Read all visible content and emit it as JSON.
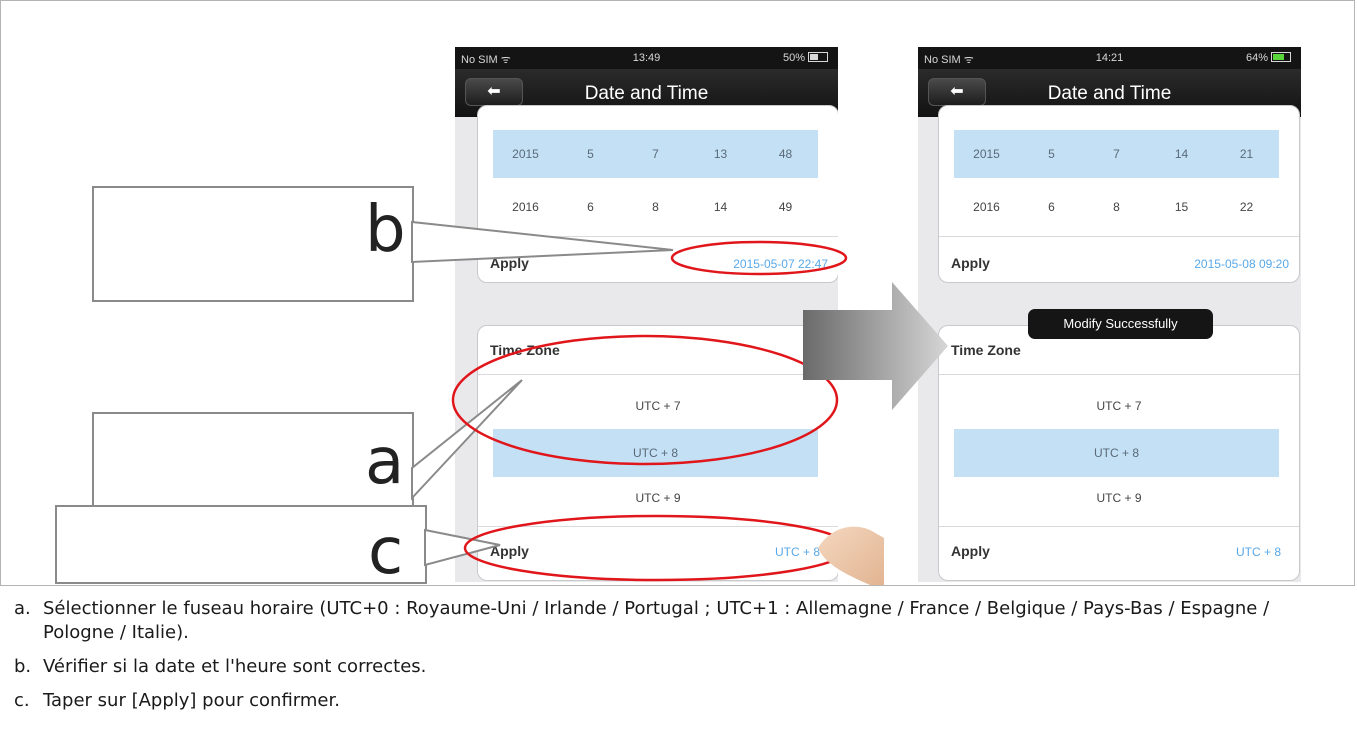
{
  "status_bar": {
    "left": {
      "carrier": "No SIM ᯤ",
      "time": "13:49",
      "battery": "50%",
      "battery_level": 0.5
    },
    "right": {
      "carrier": "No SIM ᯤ",
      "time": "14:21",
      "battery": "64%",
      "battery_level": 0.64
    }
  },
  "nav": {
    "title": "Date and Time",
    "back_icon": "back-arrow-icon"
  },
  "left_screen": {
    "date_rows": [
      {
        "year": "2015",
        "month": "5",
        "day": "7",
        "hour": "13",
        "minute": "48"
      },
      {
        "year": "2016",
        "month": "6",
        "day": "8",
        "hour": "14",
        "minute": "49"
      }
    ],
    "apply_label": "Apply",
    "datetime_value": "2015-05-07 22:47",
    "tz_title": "Time Zone",
    "tz_options": [
      "UTC + 7",
      "UTC + 8",
      "UTC + 9"
    ],
    "tz_apply_label": "Apply",
    "tz_value": "UTC + 8"
  },
  "right_screen": {
    "date_rows": [
      {
        "year": "2015",
        "month": "5",
        "day": "7",
        "hour": "14",
        "minute": "21"
      },
      {
        "year": "2016",
        "month": "6",
        "day": "8",
        "hour": "15",
        "minute": "22"
      }
    ],
    "apply_label": "Apply",
    "datetime_value": "2015-05-08 09:20",
    "toast": "Modify Successfully",
    "tz_title": "Time Zone",
    "tz_options": [
      "UTC + 7",
      "UTC + 8",
      "UTC + 9"
    ],
    "tz_apply_label": "Apply",
    "tz_value": "UTC + 8"
  },
  "callouts": {
    "a": "a",
    "b": "b",
    "c": "c"
  },
  "colors": {
    "highlight": "#c4e0f5",
    "accent_blue": "#58a8e8",
    "annotation_red": "#e0161b"
  },
  "steps": [
    {
      "letter": "a.",
      "text": "Sélectionner le fuseau horaire (UTC+0 : Royaume-Uni / Irlande / Portugal ; UTC+1 : Allemagne / France / Belgique / Pays-Bas / Espagne / Pologne / Italie)."
    },
    {
      "letter": "b.",
      "text": "Vérifier si la date et l'heure sont correctes."
    },
    {
      "letter": "c.",
      "text": "Taper sur [Apply] pour confirmer."
    }
  ]
}
